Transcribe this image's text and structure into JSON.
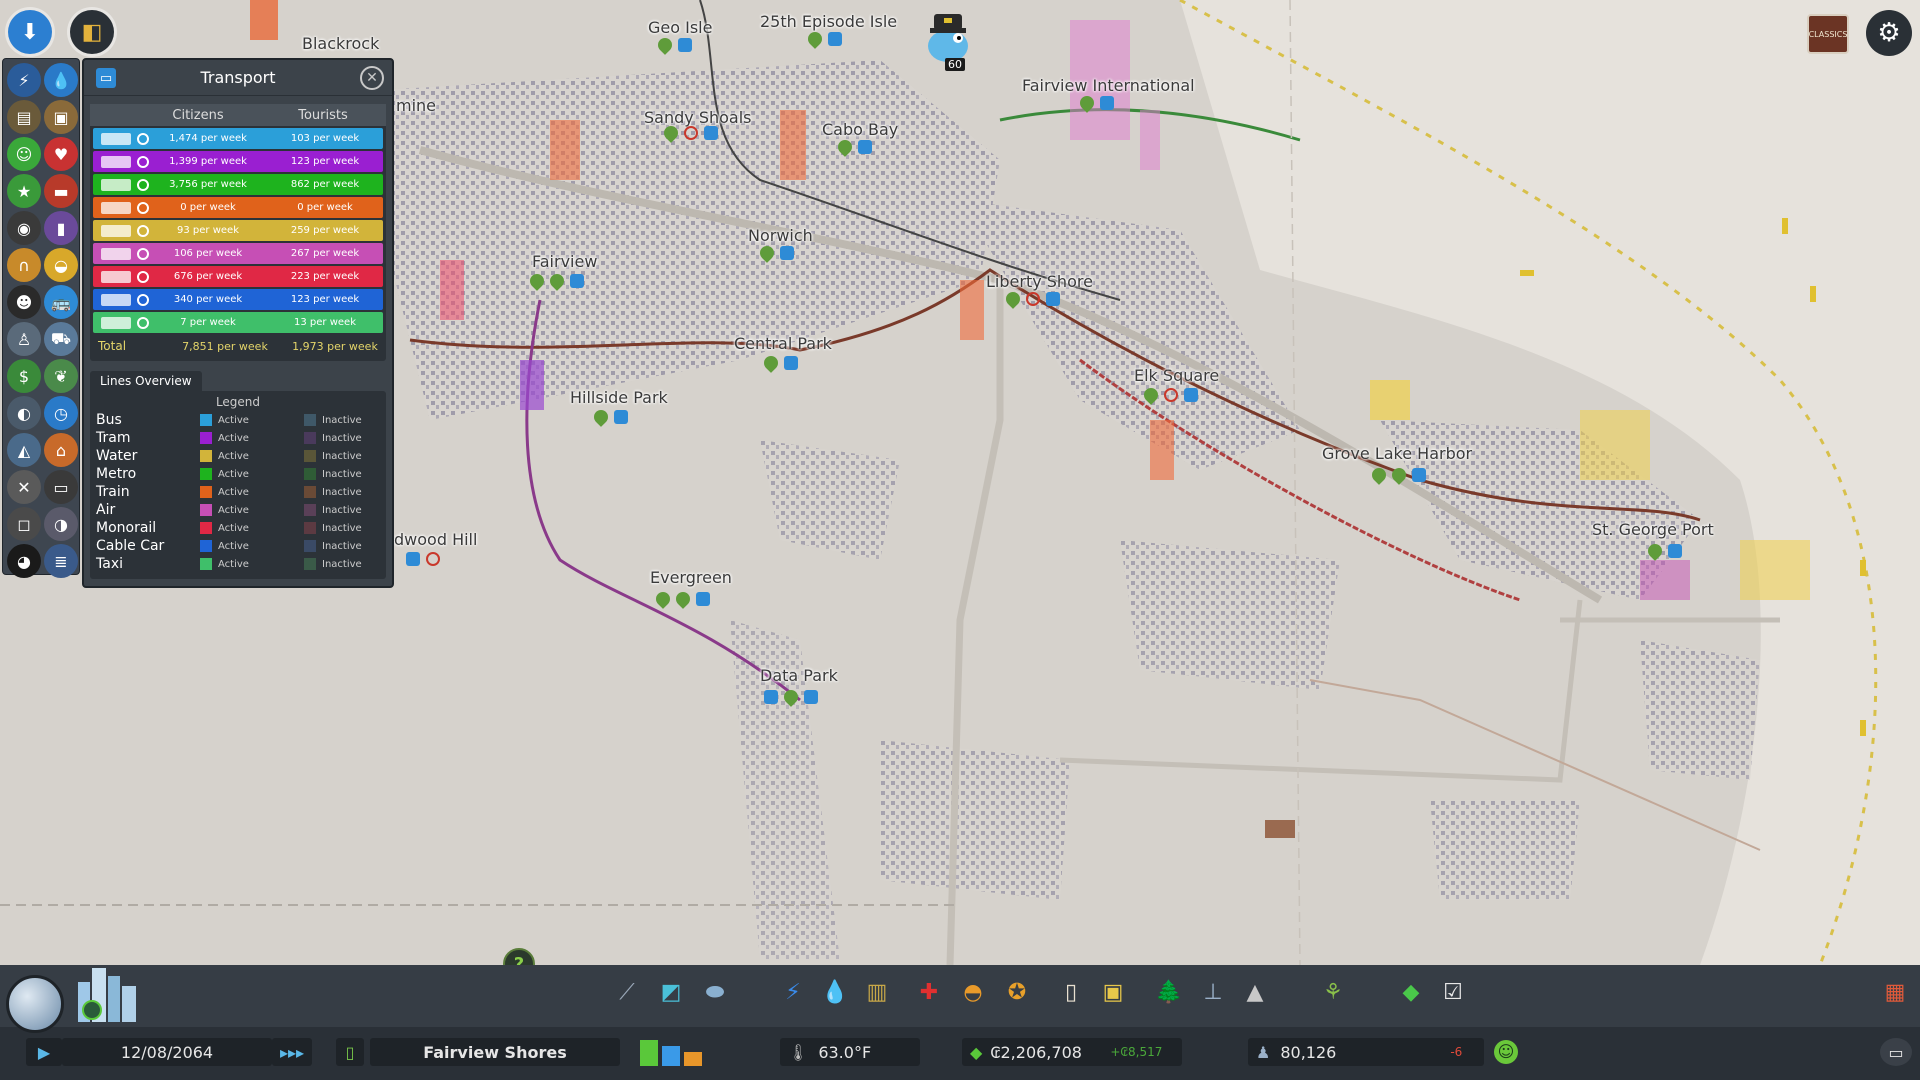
{
  "map": {
    "districts": [
      {
        "name": "Blackrock"
      },
      {
        "name": "Geo Isle"
      },
      {
        "name": "25th Episode Isle"
      },
      {
        "name": "Fairview International"
      },
      {
        "name": "Sandy Shoals"
      },
      {
        "name": "Cabo Bay"
      },
      {
        "name": "Norwich"
      },
      {
        "name": "Liberty Shore"
      },
      {
        "name": "Fairview"
      },
      {
        "name": "Central Park"
      },
      {
        "name": "Elk Square"
      },
      {
        "name": "Hillside Park"
      },
      {
        "name": "Grove Lake Harbor"
      },
      {
        "name": "St. George Port"
      },
      {
        "name": "dwood Hill"
      },
      {
        "name": "Evergreen"
      },
      {
        "name": "Data Park"
      },
      {
        "name": "mine"
      }
    ]
  },
  "chirper": {
    "count": "60",
    "icon": "chirper-bird-icon"
  },
  "top_right": {
    "classics_label": "CLASSICS",
    "settings_icon": "gear-icon"
  },
  "transport_panel": {
    "title": "Transport",
    "icon": "bus-icon",
    "close_icon": "close-icon",
    "col_citizens": "Citizens",
    "col_tourists": "Tourists",
    "rows": [
      {
        "mode": "bus",
        "citizens": "1,474 per week",
        "tourists": "103 per week",
        "color": "#2b9fd9"
      },
      {
        "mode": "tram",
        "citizens": "1,399 per week",
        "tourists": "123 per week",
        "color": "#9a1fd1"
      },
      {
        "mode": "metro",
        "citizens": "3,756 per week",
        "tourists": "862 per week",
        "color": "#1eb31e"
      },
      {
        "mode": "train",
        "citizens": "0 per week",
        "tourists": "0 per week",
        "color": "#e0621b"
      },
      {
        "mode": "ship",
        "citizens": "93 per week",
        "tourists": "259 per week",
        "color": "#d2b43a"
      },
      {
        "mode": "airplane",
        "citizens": "106 per week",
        "tourists": "267 per week",
        "color": "#c64fb5"
      },
      {
        "mode": "monorail",
        "citizens": "676 per week",
        "tourists": "223 per week",
        "color": "#e02845"
      },
      {
        "mode": "cable-car",
        "citizens": "340 per week",
        "tourists": "123 per week",
        "color": "#1f64d6"
      },
      {
        "mode": "taxi",
        "citizens": "7 per week",
        "tourists": "13 per week",
        "color": "#3fbf6a"
      }
    ],
    "total": {
      "label": "Total",
      "citizens": "7,851 per week",
      "tourists": "1,973 per week"
    },
    "lines_tab": "Lines Overview",
    "legend_title": "Legend",
    "legend": [
      {
        "name": "Bus",
        "active": "Active",
        "inactive": "Inactive",
        "color": "#2b9fd9",
        "inactive_color": "#3f5868"
      },
      {
        "name": "Tram",
        "active": "Active",
        "inactive": "Inactive",
        "color": "#9a1fd1",
        "inactive_color": "#4a3a5c"
      },
      {
        "name": "Water",
        "active": "Active",
        "inactive": "Inactive",
        "color": "#d2b43a",
        "inactive_color": "#5a5638"
      },
      {
        "name": "Metro",
        "active": "Active",
        "inactive": "Inactive",
        "color": "#1eb31e",
        "inactive_color": "#2f5c36"
      },
      {
        "name": "Train",
        "active": "Active",
        "inactive": "Inactive",
        "color": "#e0621b",
        "inactive_color": "#6a4a36"
      },
      {
        "name": "Air",
        "active": "Active",
        "inactive": "Inactive",
        "color": "#c64fb5",
        "inactive_color": "#5a4058"
      },
      {
        "name": "Monorail",
        "active": "Active",
        "inactive": "Inactive",
        "color": "#e02845",
        "inactive_color": "#5c3a42"
      },
      {
        "name": "Cable Car",
        "active": "Active",
        "inactive": "Inactive",
        "color": "#1f64d6",
        "inactive_color": "#3a4a66"
      },
      {
        "name": "Taxi",
        "active": "Active",
        "inactive": "Inactive",
        "color": "#3fbf6a",
        "inactive_color": "#3a5a48"
      }
    ]
  },
  "status_bar": {
    "date": "12/08/2064",
    "city_name": "Fairview Shores",
    "temperature": "63.0°F",
    "money": "₢2,206,708",
    "income": "+₢8,517",
    "population": "80,126",
    "population_change": "-6"
  },
  "help_label": "?"
}
